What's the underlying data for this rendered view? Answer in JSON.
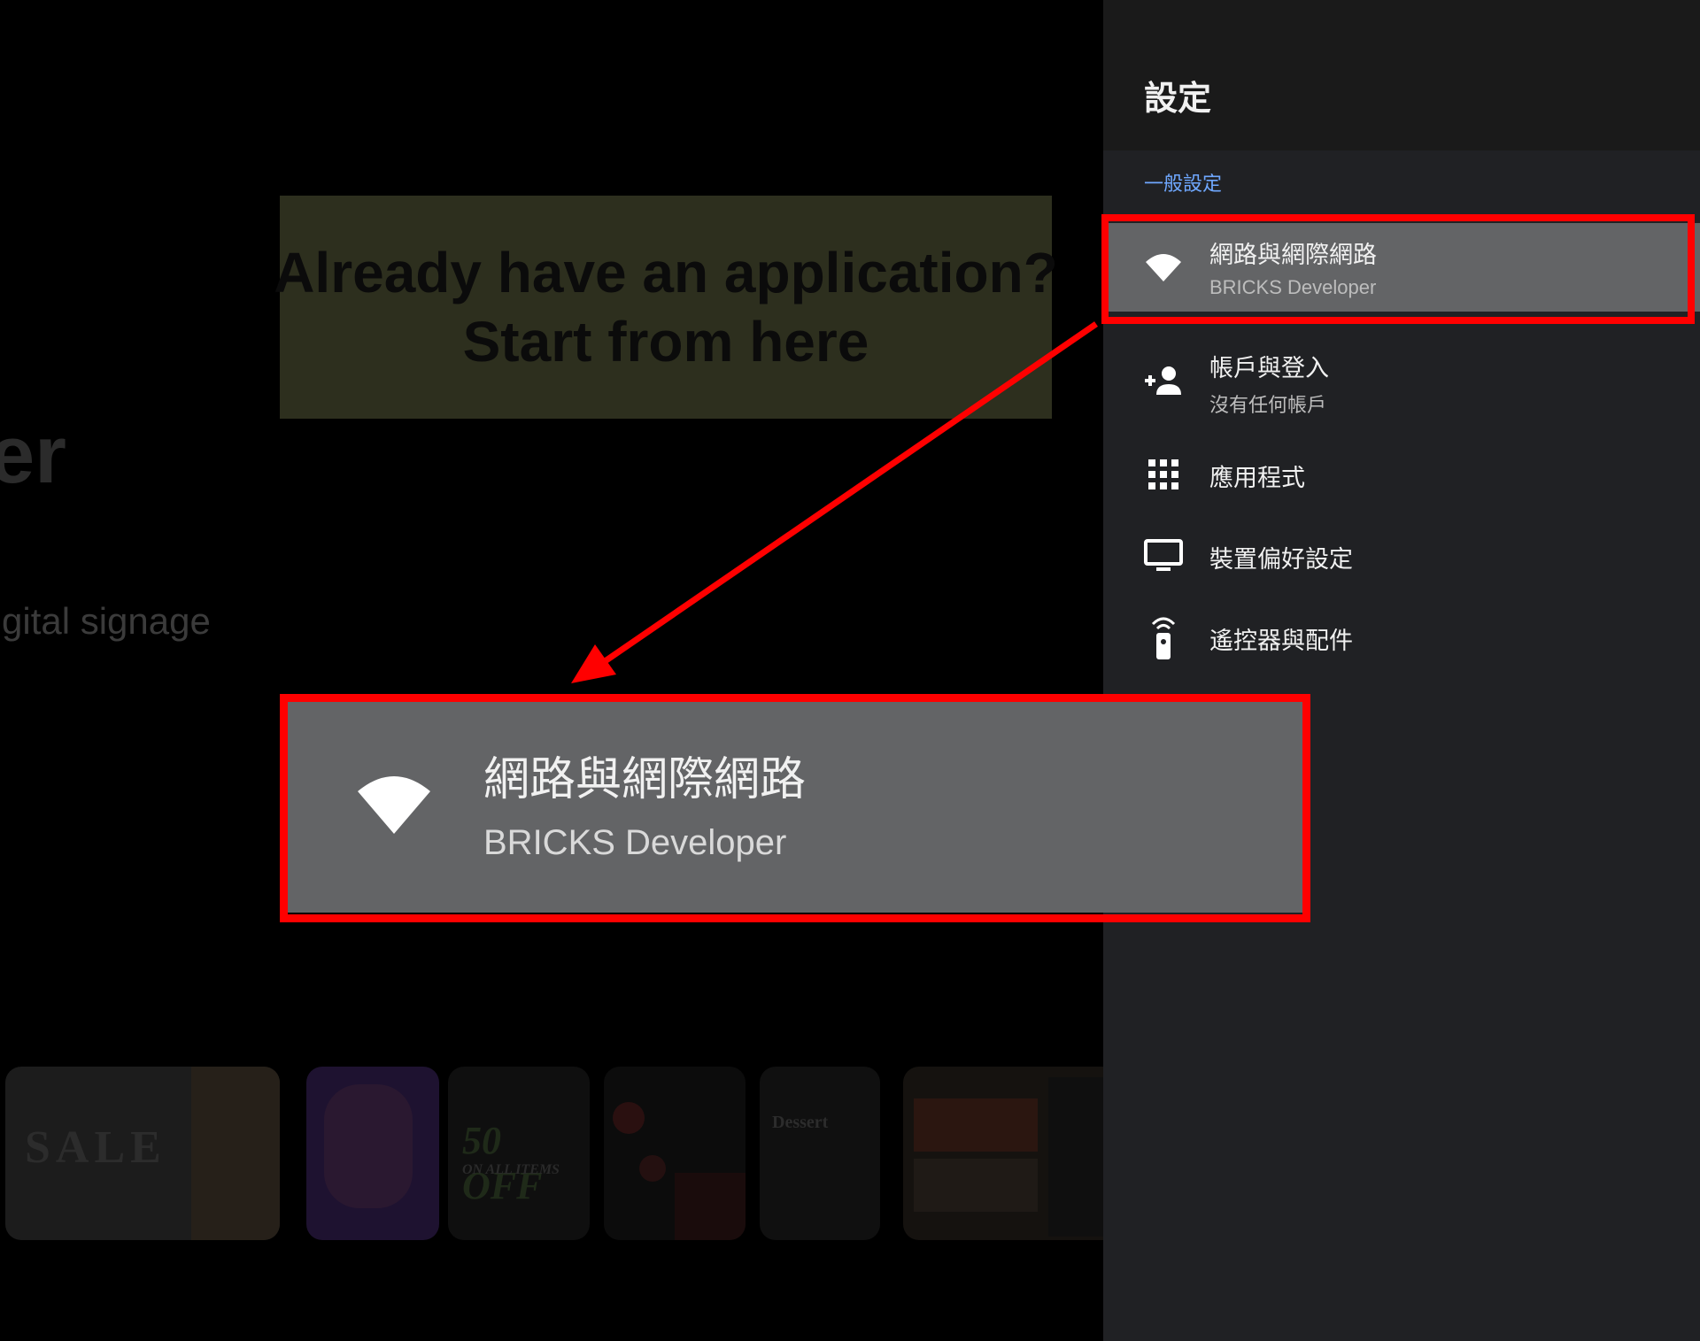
{
  "background": {
    "title_fragment": "er",
    "subtitle_fragment": "gital signage",
    "thumbnails": [
      {
        "text_main": "SALE"
      },
      {
        "text_main": ""
      },
      {
        "text_main": "50 OFF",
        "text_sub": "ON ALL ITEMS"
      },
      {
        "text_main": ""
      },
      {
        "text_main": "Dessert"
      },
      {
        "text_main": ""
      }
    ]
  },
  "callout": {
    "line1": "Already have an application?",
    "line2": "Start from here"
  },
  "settings": {
    "title": "設定",
    "section": "一般設定",
    "items": [
      {
        "label": "網路與網際網路",
        "sub": "BRICKS Developer",
        "icon": "wifi-icon"
      },
      {
        "label": "帳戶與登入",
        "sub": "沒有任何帳戶",
        "icon": "add-person-icon"
      },
      {
        "label": "應用程式",
        "icon": "apps-grid-icon"
      },
      {
        "label": "裝置偏好設定",
        "icon": "tv-icon"
      },
      {
        "label": "遙控器與配件",
        "icon": "remote-icon"
      }
    ]
  },
  "zoom": {
    "label": "網路與網際網路",
    "sub": "BRICKS Developer"
  },
  "colors": {
    "highlight": "#ff0000",
    "panel": "#202124",
    "selected": "#636466",
    "callout_bg": "#2d2f1e",
    "section_label": "#6fa8ff"
  }
}
